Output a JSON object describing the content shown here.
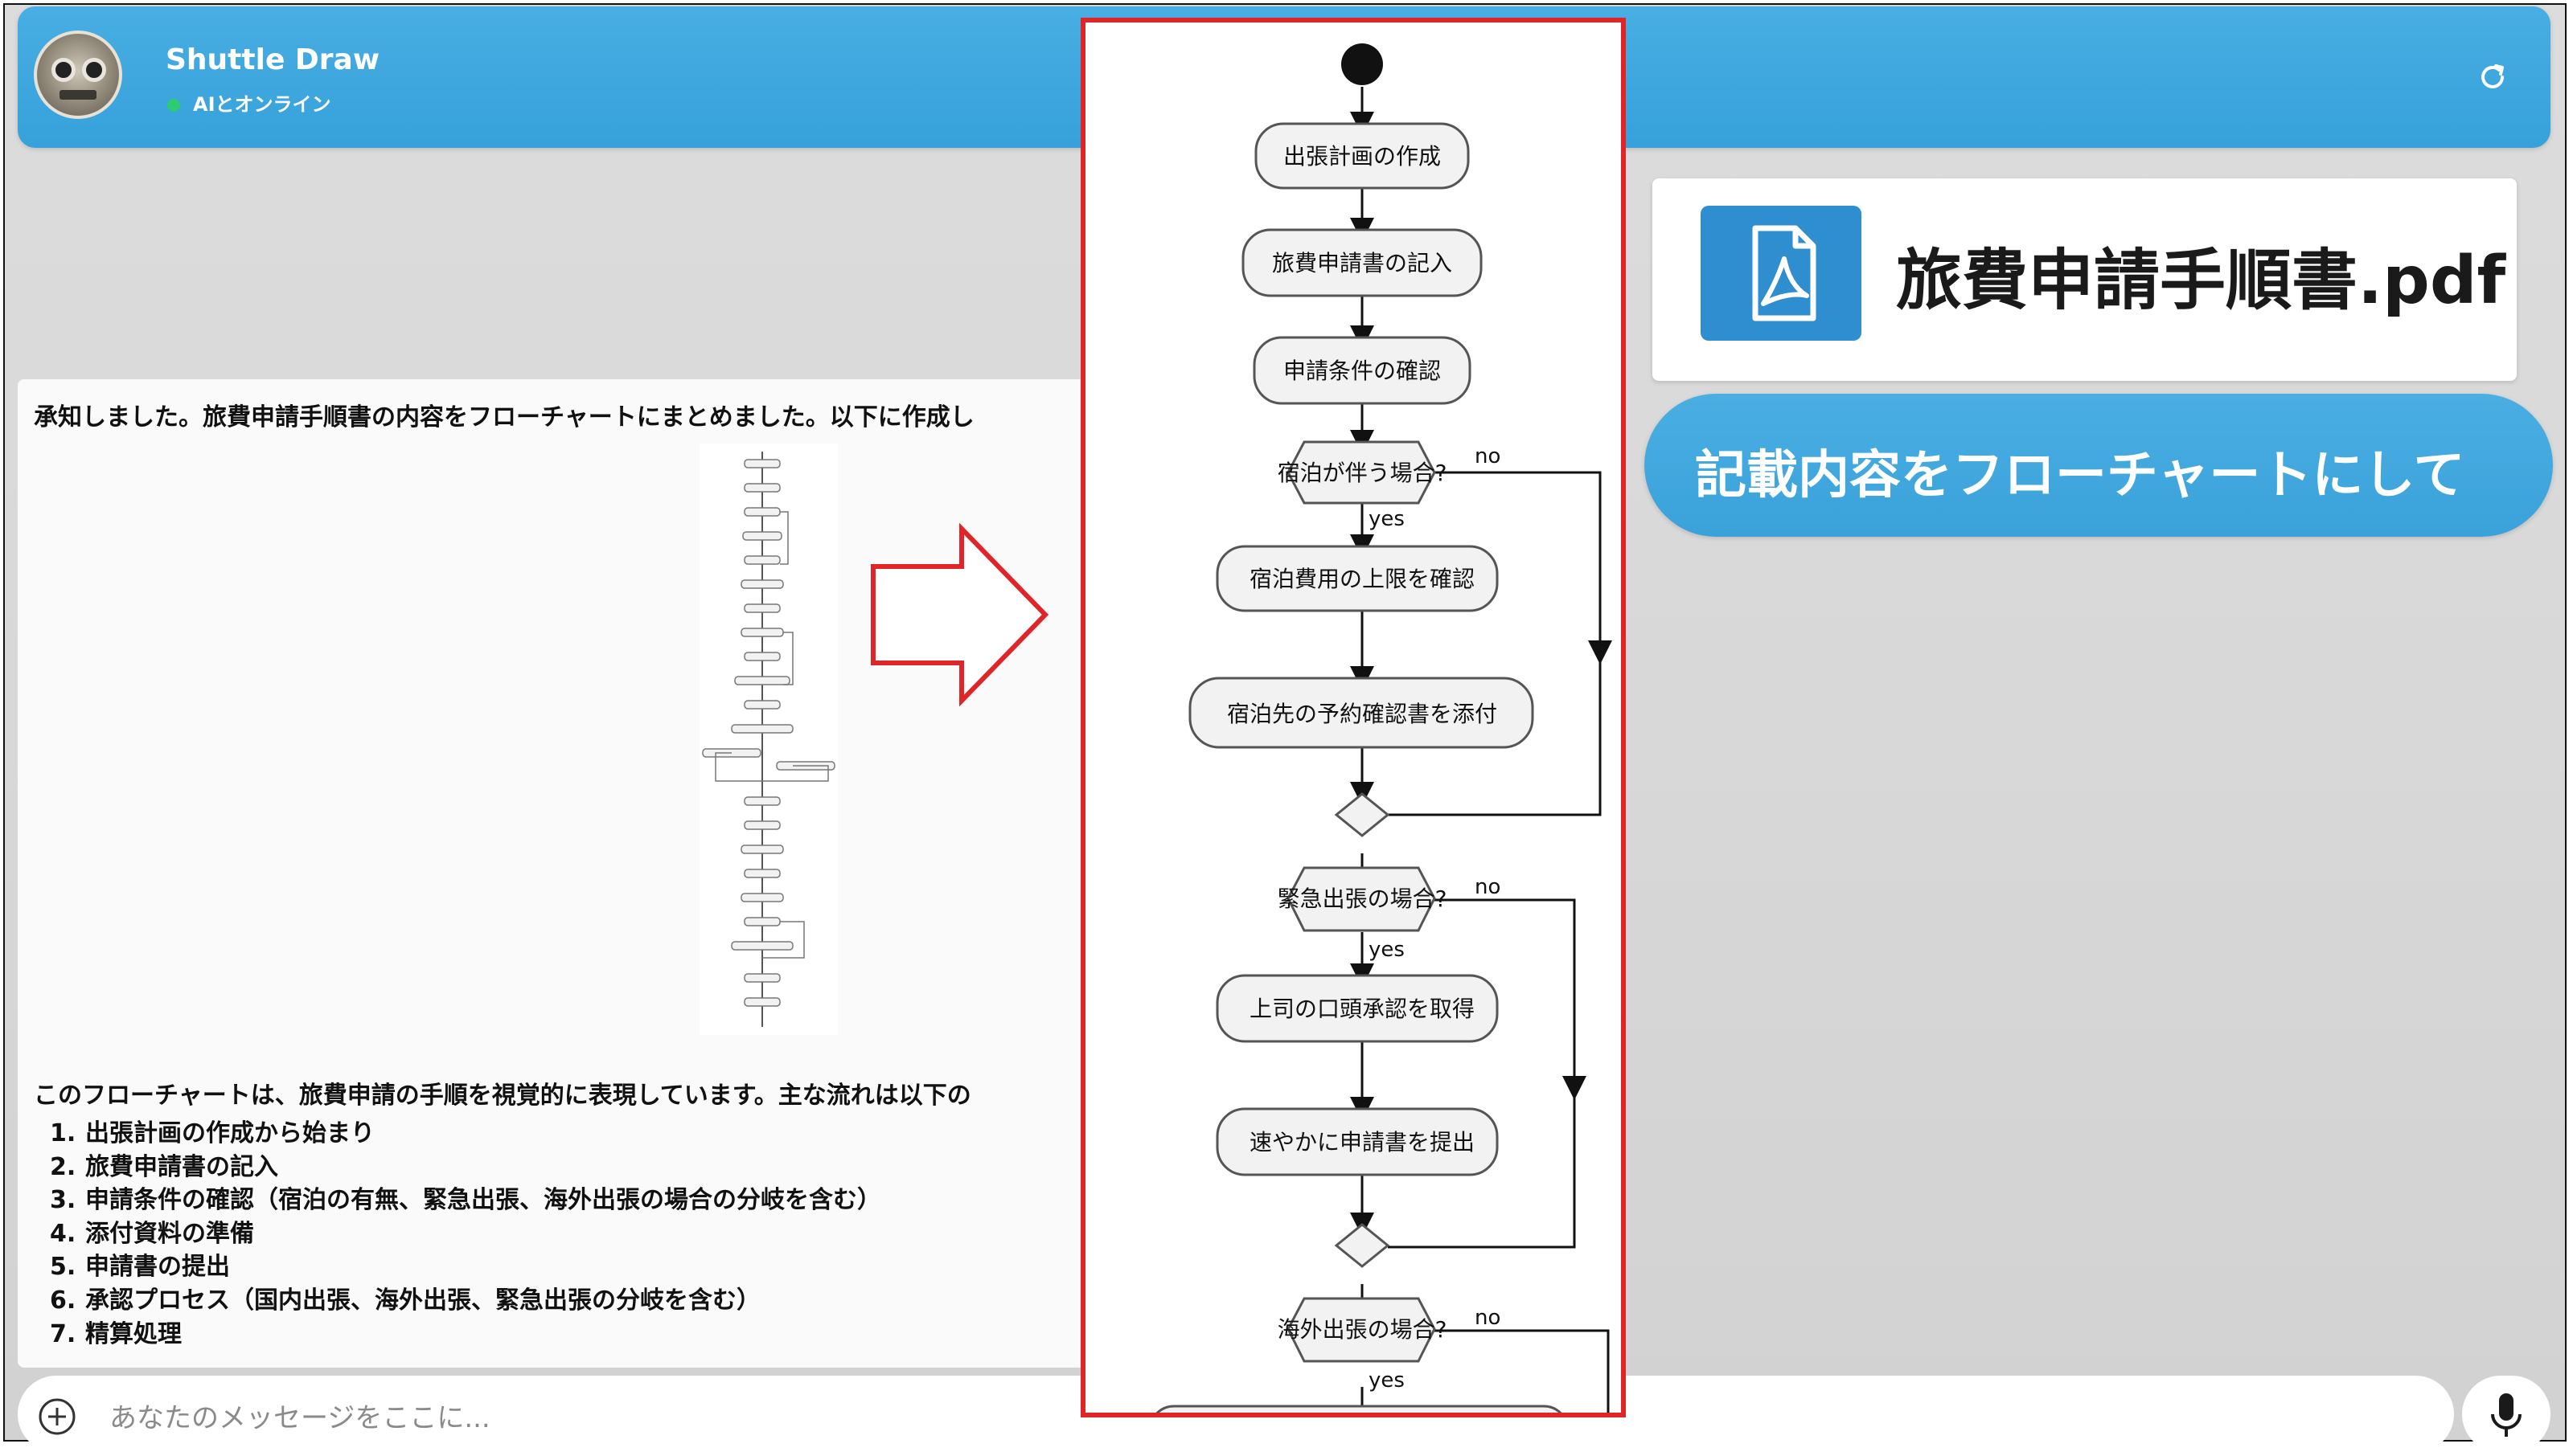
{
  "header": {
    "app_title": "Shuttle Draw",
    "status": "AIとオンライン"
  },
  "chat": {
    "intro": "承知しました。旅費申請手順書の内容をフローチャートにまとめました。以下に作成し",
    "summary": "このフローチャートは、旅費申請の手順を視覚的に表現しています。主な流れは以下の",
    "steps": [
      {
        "num": "1.",
        "text": "出張計画の作成から始まり"
      },
      {
        "num": "2.",
        "text": "旅費申請書の記入"
      },
      {
        "num": "3.",
        "text": "申請条件の確認（宿泊の有無、緊急出張、海外出張の場合の分岐を含む）"
      },
      {
        "num": "4.",
        "text": "添付資料の準備"
      },
      {
        "num": "5.",
        "text": "申請書の提出"
      },
      {
        "num": "6.",
        "text": "承認プロセス（国内出張、海外出張、緊急出張の分岐を含む）"
      },
      {
        "num": "7.",
        "text": "精算処理"
      }
    ]
  },
  "input": {
    "placeholder": "あなたのメッセージをここに..."
  },
  "attachment": {
    "file_name": "旅費申請手順書.pdf",
    "icon": "pdf-icon"
  },
  "user_message": "記載内容をフローチャートにして",
  "flowchart": {
    "nodes": {
      "n1": "出張計画の作成",
      "n2": "旅費申請書の記入",
      "n3": "申請条件の確認",
      "d1": "宿泊が伴う場合?",
      "n4": "宿泊費用の上限を確認",
      "n5": "宿泊先の予約確認書を添付",
      "d2": "緊急出張の場合?",
      "n6": "上司の口頭承認を取得",
      "n7": "速やかに申請書を提出",
      "d3": "海外出張の場合?"
    },
    "yes": "yes",
    "no": "no"
  },
  "colors": {
    "header_blue": "#3aa6de",
    "highlight_red": "#e02528",
    "pdf_blue": "#2f8ecf"
  }
}
